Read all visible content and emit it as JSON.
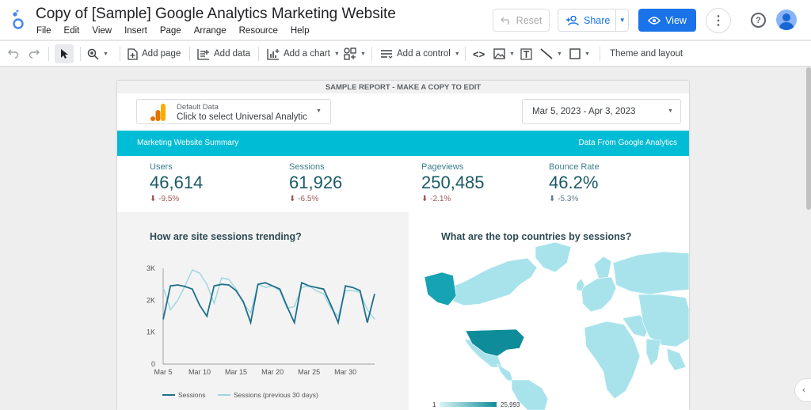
{
  "app": {
    "title": "Copy of [Sample] Google Analytics Marketing Website",
    "menu": [
      "File",
      "Edit",
      "View",
      "Insert",
      "Page",
      "Arrange",
      "Resource",
      "Help"
    ]
  },
  "header": {
    "reset_label": "Reset",
    "share_label": "Share",
    "view_label": "View"
  },
  "toolbar": {
    "add_page": "Add page",
    "add_data": "Add data",
    "add_chart": "Add a chart",
    "add_control": "Add a control",
    "theme": "Theme and layout"
  },
  "report": {
    "banner": "SAMPLE REPORT - MAKE A COPY TO EDIT",
    "datasource": {
      "label": "Default Data",
      "value": "Click to select Universal Analytic"
    },
    "date_range": "Mar 5, 2023 - Apr 3, 2023",
    "section_title": "Marketing Website Summary",
    "section_source": "Data From Google Analytics",
    "kpis": [
      {
        "label": "Users",
        "value": "46,614",
        "delta": "-9.5%"
      },
      {
        "label": "Sessions",
        "value": "61,926",
        "delta": "-6.5%"
      },
      {
        "label": "Pageviews",
        "value": "250,485",
        "delta": "-2.1%"
      },
      {
        "label": "Bounce Rate",
        "value": "46.2%",
        "delta": "-5.3%"
      }
    ],
    "trend_title": "How are site sessions trending?",
    "map_title": "What are the top countries by sessions?",
    "map_legend": {
      "min": "1",
      "max": "25,993"
    }
  },
  "colors": {
    "accent": "#00bcd4",
    "series1": "#1f6f8b",
    "series2": "#9fd7e0",
    "brand": "#1a73e8"
  },
  "chart_data": {
    "type": "line",
    "categories": [
      "Mar 5",
      "Mar 6",
      "Mar 7",
      "Mar 8",
      "Mar 9",
      "Mar 10",
      "Mar 11",
      "Mar 12",
      "Mar 13",
      "Mar 14",
      "Mar 15",
      "Mar 16",
      "Mar 17",
      "Mar 18",
      "Mar 19",
      "Mar 20",
      "Mar 21",
      "Mar 22",
      "Mar 23",
      "Mar 24",
      "Mar 25",
      "Mar 26",
      "Mar 27",
      "Mar 28",
      "Mar 29",
      "Mar 30",
      "Mar 31",
      "Apr 1",
      "Apr 2",
      "Apr 3"
    ],
    "x_ticks": [
      "Mar 5",
      "Mar 10",
      "Mar 15",
      "Mar 20",
      "Mar 25",
      "Mar 30"
    ],
    "y_ticks": [
      "0",
      "1K",
      "2K",
      "3K"
    ],
    "ylim": [
      0,
      3000
    ],
    "series": [
      {
        "name": "Sessions",
        "values": [
          1400,
          2450,
          2480,
          2430,
          2350,
          1850,
          1500,
          2450,
          2500,
          2480,
          2300,
          1950,
          1300,
          2500,
          2550,
          2450,
          2350,
          1800,
          1300,
          2550,
          2450,
          2400,
          2350,
          1850,
          1300,
          2450,
          2400,
          2300,
          1300,
          2200
        ]
      },
      {
        "name": "Sessions (previous 30 days)",
        "values": [
          2400,
          1700,
          2000,
          2450,
          2950,
          2850,
          2500,
          1900,
          2700,
          2650,
          2350,
          1900,
          1600,
          2500,
          2400,
          2450,
          2300,
          1750,
          1800,
          2400,
          2450,
          2300,
          2200,
          1750,
          1500,
          2300,
          2300,
          2250,
          1700,
          1400
        ]
      }
    ],
    "legend_position": "bottom"
  }
}
